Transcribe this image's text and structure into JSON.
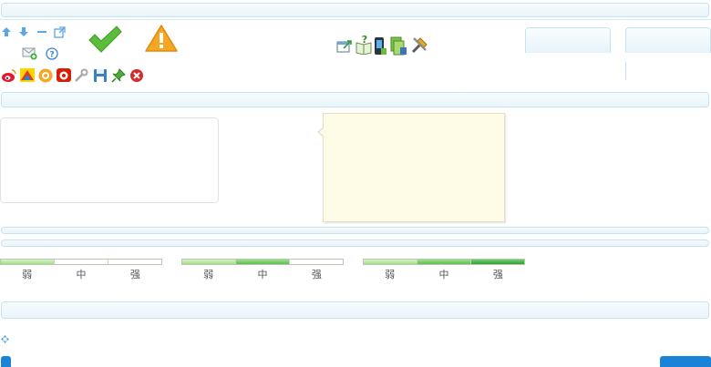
{
  "strength_meters": [
    {
      "labels": [
        "弱",
        "中",
        "强"
      ],
      "level": 1
    },
    {
      "labels": [
        "弱",
        "中",
        "强"
      ],
      "level": 2
    },
    {
      "labels": [
        "弱",
        "中",
        "强"
      ],
      "level": 3
    }
  ],
  "colors": {
    "bar_border": "#c6e3f0",
    "bar_fill": "#eaf5fb",
    "tooltip_fill": "#fefce6",
    "meter_weak": "#a4dd86",
    "meter_medium": "#5cbf4d",
    "meter_strong": "#2f9d3a",
    "primary_button": "#1a83d8"
  },
  "icons": {
    "toolbar_row1": [
      "arrow-up-icon",
      "arrow-down-icon",
      "minimize-icon",
      "popout-icon"
    ],
    "toolbar_row2": [
      "mail-add-icon",
      "help-icon"
    ],
    "status": [
      "checkmark-icon",
      "warning-icon"
    ],
    "center_tools": [
      "export-icon",
      "help-book-icon",
      "mobile-device-icon",
      "document-stack-icon",
      "tools-icon"
    ],
    "social": [
      "weibo-icon",
      "qzone-icon",
      "tencent-weibo-icon",
      "wangyi-icon",
      "wrench-icon",
      "save-icon",
      "pin-icon",
      "close-circle-icon"
    ]
  }
}
